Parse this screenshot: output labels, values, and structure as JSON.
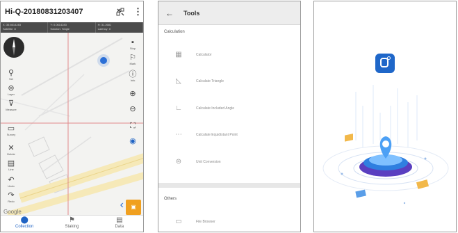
{
  "screen1": {
    "title": "Hi-Q-20180831203407",
    "coord_cells": [
      {
        "line1": "X: 35.6614283",
        "line2": "Satellite: 8"
      },
      {
        "line1": "Y: 0.0614283",
        "line2": "Solution: Single"
      },
      {
        "line1": "H: 31.2681",
        "line2": "Latency: 0"
      }
    ],
    "left_tools": [
      "Set",
      "Layer",
      "Measure",
      "Survey",
      "Delete",
      "Line",
      "Undo",
      "Redo"
    ],
    "right_tools": [
      "Stop",
      "Mark",
      "Info"
    ],
    "google_label": "Google",
    "nav": [
      {
        "label": "Collection",
        "icon": "location-pin-icon"
      },
      {
        "label": "Staking",
        "icon": "staking-icon"
      },
      {
        "label": "Data",
        "icon": "data-icon"
      }
    ]
  },
  "screen2": {
    "title": "Tools",
    "section1": "Calculation",
    "items1": [
      "Calculator",
      "Calculate Triangle",
      "Calculate Included Angle",
      "Calculate Equidistant Point",
      "Unit Conversion"
    ],
    "section2": "Others",
    "items2": [
      "File Browser"
    ]
  },
  "colors": {
    "accent_blue": "#1f63c4",
    "orange": "#f0a020",
    "coord_bar": "#4b4b4b",
    "crosshair": "#e08a8a"
  }
}
